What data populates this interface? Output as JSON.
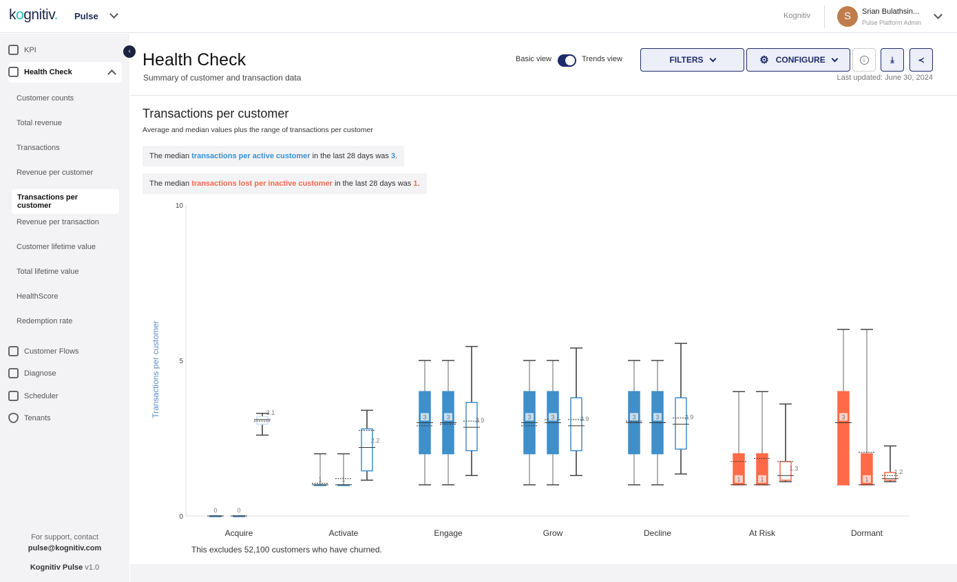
{
  "header": {
    "logo": "kognitiv",
    "app": "Pulse",
    "tenant": "Kognitiv",
    "user_initial": "S",
    "user_name": "Srian Bulathsin...",
    "user_role": "Pulse Platform Admin"
  },
  "sidebar": {
    "kpi": "KPI",
    "health_check": "Health Check",
    "sub_items": [
      "Customer counts",
      "Total revenue",
      "Transactions",
      "Revenue per customer",
      "Transactions per customer",
      "Revenue per transaction",
      "Customer lifetime value",
      "Total lifetime value",
      "HealthScore",
      "Redemption rate"
    ],
    "active": "Transactions per customer",
    "other": [
      "Customer Flows",
      "Diagnose",
      "Scheduler",
      "Tenants"
    ],
    "support_line": "For support, contact",
    "support_email": "pulse@kognitiv.com",
    "product": "Kognitiv Pulse",
    "version": "v1.0"
  },
  "page": {
    "title": "Health Check",
    "subtitle": "Summary of customer and transaction data",
    "basic_view": "Basic view",
    "trends_view": "Trends view",
    "trends_on": true,
    "filters": "FILTERS",
    "configure": "CONFIGURE",
    "last_updated": "Last updated: June 30, 2024"
  },
  "section": {
    "title": "Transactions per customer",
    "description": "Average and median values plus the range of transactions per customer",
    "banner1": {
      "pre": "The median ",
      "hl": "transactions per active customer",
      "mid": " in the last 28 days was ",
      "val": "3",
      "post": "."
    },
    "banner2": {
      "pre": "The median ",
      "hl": "transactions lost per inactive customer",
      "mid": " in the last 28 days was ",
      "val": "1",
      "post": "."
    },
    "note": "This excludes 52,100 customers who have churned."
  },
  "colors": {
    "active": "#3f8fca",
    "inactive": "#ff6a48",
    "navy": "#1d2a6b"
  },
  "chart_data": {
    "type": "box",
    "ylabel": "Transactions per customer",
    "ylim": [
      0,
      10
    ],
    "yticks": [
      0,
      5,
      10
    ],
    "categories": [
      "Acquire",
      "Activate",
      "Engage",
      "Grow",
      "Decline",
      "At Risk",
      "Dormant"
    ],
    "groups": [
      [
        {
          "min": 0,
          "q1": 0,
          "median": 0,
          "q3": 0,
          "max": 0,
          "mean": 0,
          "label": "0",
          "style": "filled"
        },
        {
          "min": 0,
          "q1": 0,
          "median": 0,
          "q3": 0,
          "max": 0,
          "mean": 0,
          "label": "0",
          "style": "filled"
        },
        {
          "min": 2.6,
          "q1": 2.95,
          "median": 3.1,
          "q3": 3.2,
          "max": 3.3,
          "mean": 3.05,
          "label": "3.1",
          "style": "outline"
        }
      ],
      [
        {
          "min": 1,
          "q1": 1,
          "median": 1,
          "q3": 1,
          "max": 2,
          "mean": 1.05,
          "label": "1",
          "style": "filled"
        },
        {
          "min": 1,
          "q1": 1,
          "median": 1,
          "q3": 1,
          "max": 2,
          "mean": 1.2,
          "label": "1",
          "style": "filled"
        },
        {
          "min": 1.15,
          "q1": 1.45,
          "median": 2.2,
          "q3": 2.8,
          "max": 3.4,
          "mean": 2.75,
          "label": "2.2",
          "style": "outline"
        }
      ],
      [
        {
          "min": 1,
          "q1": 2,
          "median": 3,
          "q3": 4,
          "max": 5,
          "mean": 2.9,
          "label": "3",
          "style": "filled"
        },
        {
          "min": 1,
          "q1": 2,
          "median": 3,
          "q3": 4,
          "max": 5,
          "mean": 2.95,
          "label": "3",
          "style": "filled"
        },
        {
          "min": 1.3,
          "q1": 2.1,
          "median": 2.85,
          "q3": 3.65,
          "max": 5.45,
          "mean": 3.05,
          "label": "2.9",
          "style": "outline"
        }
      ],
      [
        {
          "min": 1,
          "q1": 2,
          "median": 3,
          "q3": 4,
          "max": 5,
          "mean": 2.9,
          "label": "3",
          "style": "filled"
        },
        {
          "min": 1,
          "q1": 2,
          "median": 3,
          "q3": 4,
          "max": 5,
          "mean": 3.1,
          "label": "3",
          "style": "filled"
        },
        {
          "min": 1.3,
          "q1": 2.1,
          "median": 2.9,
          "q3": 3.8,
          "max": 5.4,
          "mean": 3.1,
          "label": "2.9",
          "style": "outline"
        }
      ],
      [
        {
          "min": 1,
          "q1": 2,
          "median": 3,
          "q3": 4,
          "max": 5,
          "mean": 3.05,
          "label": "3",
          "style": "filled"
        },
        {
          "min": 1,
          "q1": 2,
          "median": 3,
          "q3": 4,
          "max": 5,
          "mean": 3,
          "label": "3",
          "style": "filled"
        },
        {
          "min": 1.35,
          "q1": 2.15,
          "median": 2.95,
          "q3": 3.8,
          "max": 5.55,
          "mean": 3.15,
          "label": "2.9",
          "style": "outline"
        }
      ],
      [
        {
          "min": 1,
          "q1": 1,
          "median": 1,
          "q3": 2,
          "max": 4,
          "mean": 1.75,
          "label": "1",
          "style": "filled"
        },
        {
          "min": 1,
          "q1": 1,
          "median": 1,
          "q3": 2,
          "max": 4,
          "mean": 1.85,
          "label": "1",
          "style": "filled"
        },
        {
          "min": 1.1,
          "q1": 1.15,
          "median": 1.3,
          "q3": 1.75,
          "max": 3.6,
          "mean": 1.75,
          "label": "1.3",
          "style": "outline"
        }
      ],
      [
        {
          "min": 1,
          "q1": 1,
          "median": 3,
          "q3": 4,
          "max": 6,
          "mean": 3,
          "label": "3",
          "style": "filled"
        },
        {
          "min": 1,
          "q1": 1,
          "median": 1,
          "q3": 2,
          "max": 6,
          "mean": 2.05,
          "label": "1",
          "style": "filled"
        },
        {
          "min": 1.1,
          "q1": 1.15,
          "median": 1.2,
          "q3": 1.4,
          "max": 2.25,
          "mean": 1.3,
          "label": "1.2",
          "style": "outline"
        }
      ]
    ]
  }
}
